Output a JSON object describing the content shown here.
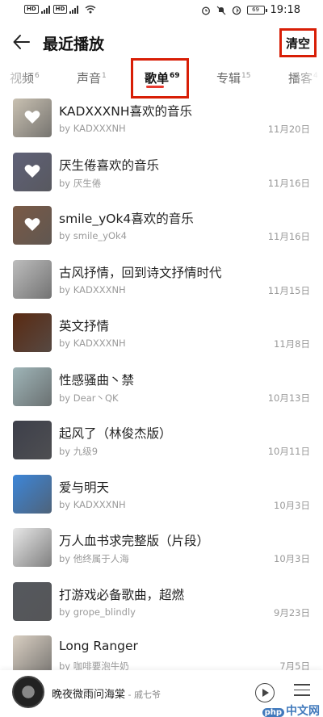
{
  "status_bar": {
    "sim1": "HD",
    "sim2": "HD",
    "network": "5G",
    "battery": "69",
    "time": "19:18"
  },
  "header": {
    "title": "最近播放",
    "clear_label": "清空"
  },
  "tabs": [
    {
      "label": "视频",
      "count": "6"
    },
    {
      "label": "声音",
      "count": "1"
    },
    {
      "label": "歌单",
      "count": "69"
    },
    {
      "label": "专辑",
      "count": "15"
    },
    {
      "label": "播客",
      "count": "4"
    }
  ],
  "playlists": [
    {
      "title": "KADXXXNH喜欢的音乐",
      "by": "by KADXXXNH",
      "date": "11月20日",
      "cover_bg": "#c9c1b2",
      "heart": true
    },
    {
      "title": "厌生倦喜欢的音乐",
      "by": "by 厌生倦",
      "date": "11月16日",
      "cover_bg": "#5f6178",
      "heart": true
    },
    {
      "title": "smile_yOk4喜欢的音乐",
      "by": "by smile_yOk4",
      "date": "11月16日",
      "cover_bg": "#7a5a46",
      "heart": true
    },
    {
      "title": "古风抒情，回到诗文抒情时代",
      "by": "by KADXXXNH",
      "date": "11月15日",
      "cover_bg": "#bdbdbd",
      "heart": false
    },
    {
      "title": "英文抒情",
      "by": "by KADXXXNH",
      "date": "11月8日",
      "cover_bg": "#5a2a12",
      "heart": false
    },
    {
      "title": "性感骚曲丶禁",
      "by": "by Dear丶QK",
      "date": "10月13日",
      "cover_bg": "#9fb5b8",
      "heart": false
    },
    {
      "title": "起风了（林俊杰版）",
      "by": "by 九级9",
      "date": "10月11日",
      "cover_bg": "#3d3f4a",
      "heart": false
    },
    {
      "title": "爱与明天",
      "by": "by KADXXXNH",
      "date": "10月3日",
      "cover_bg": "#3d86d8",
      "heart": false
    },
    {
      "title": "万人血书求完整版（片段）",
      "by": "by 他终属于人海",
      "date": "10月3日",
      "cover_bg": "#e8e8e8",
      "heart": false
    },
    {
      "title": "打游戏必备歌曲，超燃",
      "by": "by grope_blindly",
      "date": "9月23日",
      "cover_bg": "#55585e",
      "heart": false
    },
    {
      "title": "Long Ranger",
      "by": "by 咖啡要泡牛奶",
      "date": "7月5日",
      "cover_bg": "#d9cfc2",
      "heart": false
    }
  ],
  "player": {
    "song": "晚夜微雨问海棠",
    "artist": " - 戚七爷"
  },
  "watermark": {
    "badge": "php",
    "text": "中文网"
  }
}
